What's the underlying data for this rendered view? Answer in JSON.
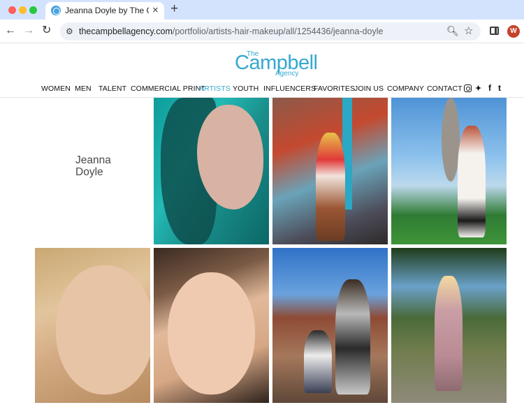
{
  "browser": {
    "tab_title": "Jeanna Doyle by The Campbell",
    "tab_close": "×",
    "new_tab": "+",
    "url_domain": "thecampbellagency.com",
    "url_path": "/portfolio/artists-hair-makeup/all/1254436/jeanna-doyle",
    "profile_initial": "W",
    "icons": {
      "back": "back-arrow-icon",
      "forward": "forward-arrow-icon",
      "reload": "reload-icon",
      "site_info": "site-info-icon",
      "zoom": "zoom-icon",
      "bookmark": "star-icon",
      "side_panel": "side-panel-icon"
    }
  },
  "site": {
    "logo": {
      "the": "The",
      "main": "Campbell",
      "agency": "Agency"
    },
    "nav": [
      {
        "label": "WOMEN",
        "active": false
      },
      {
        "label": "MEN",
        "active": false
      },
      {
        "label": "TALENT",
        "active": false
      },
      {
        "label": "COMMERCIAL PRINT",
        "active": false
      },
      {
        "label": "ARTISTS",
        "active": true
      },
      {
        "label": "YOUTH",
        "active": false
      },
      {
        "label": "INFLUENCERS",
        "active": false
      },
      {
        "label": "FAVORITES",
        "active": false
      },
      {
        "label": "JOIN US",
        "active": false
      },
      {
        "label": "COMPANY",
        "active": false
      },
      {
        "label": "CONTACT",
        "active": false
      }
    ],
    "social": {
      "instagram": "instagram-icon",
      "twitter_glyph": "🐦",
      "facebook_glyph": "f",
      "tumblr_glyph": "t"
    },
    "accent_color": "#35a8cf"
  },
  "portfolio": {
    "artist_first": "Jeanna",
    "artist_last": "Doyle"
  }
}
